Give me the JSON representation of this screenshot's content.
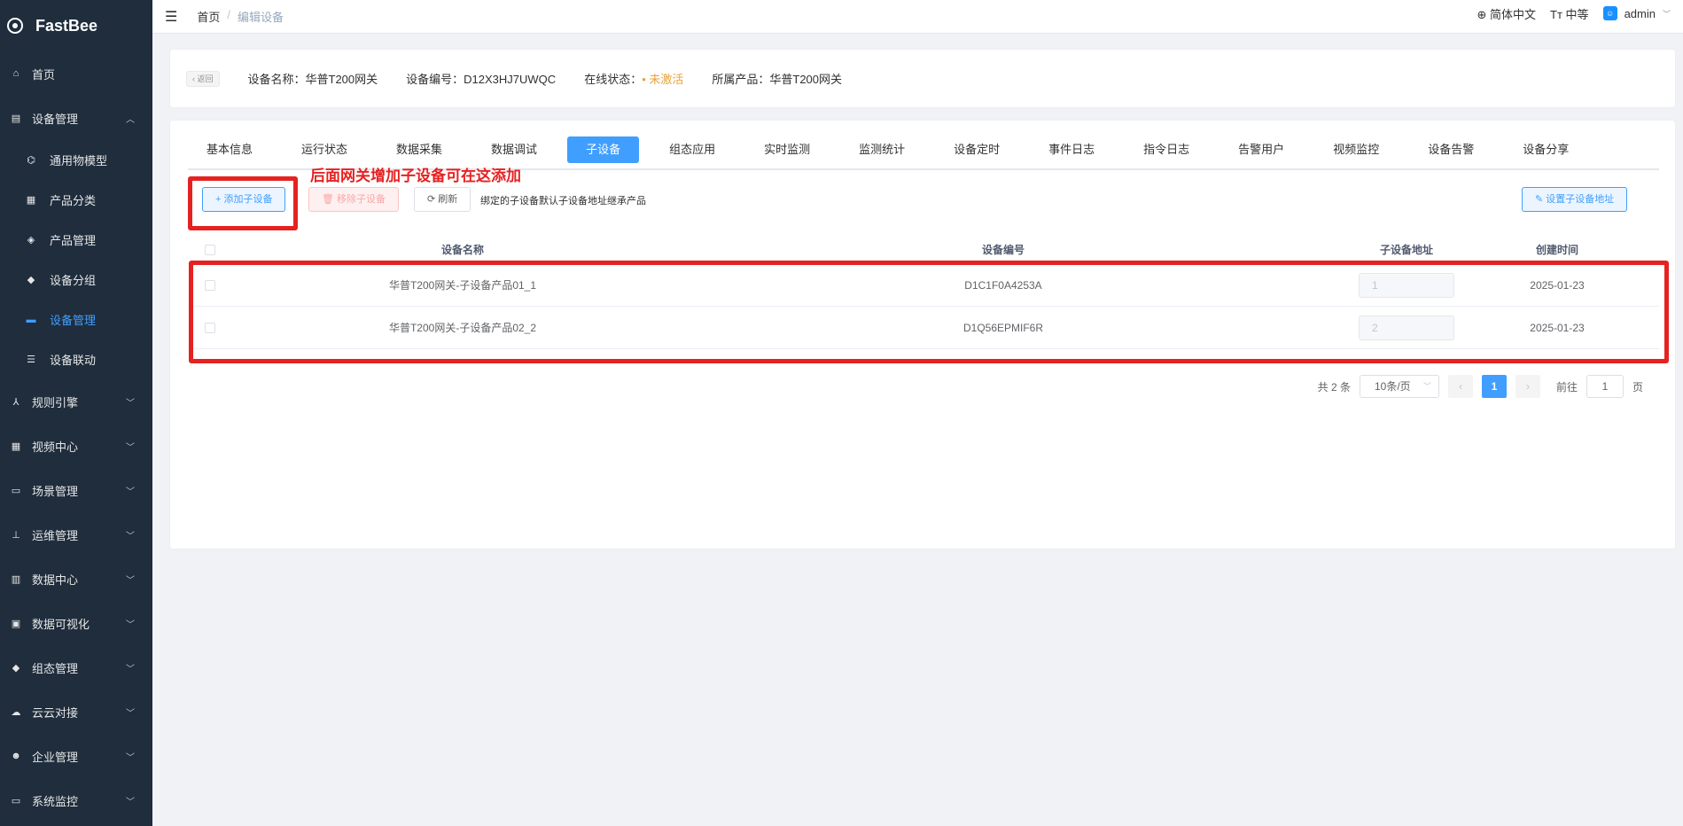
{
  "app": {
    "name": "FastBee"
  },
  "sidebar": {
    "items": [
      {
        "label": "首页",
        "icon": "home-icon",
        "glyph": "⌂"
      },
      {
        "label": "设备管理",
        "icon": "device-icon",
        "glyph": "▤",
        "expanded": true,
        "children": [
          {
            "label": "通用物模型",
            "glyph": "⌬"
          },
          {
            "label": "产品分类",
            "glyph": "▦"
          },
          {
            "label": "产品管理",
            "glyph": "◈"
          },
          {
            "label": "设备分组",
            "glyph": "◆"
          },
          {
            "label": "设备管理",
            "glyph": "▬",
            "active": true
          },
          {
            "label": "设备联动",
            "glyph": "☰"
          }
        ]
      },
      {
        "label": "规则引擎",
        "icon": "rule-icon",
        "glyph": "⅄"
      },
      {
        "label": "视频中心",
        "icon": "video-icon",
        "glyph": "▦"
      },
      {
        "label": "场景管理",
        "icon": "scene-icon",
        "glyph": "▭"
      },
      {
        "label": "运维管理",
        "icon": "ops-icon",
        "glyph": "⊥"
      },
      {
        "label": "数据中心",
        "icon": "data-icon",
        "glyph": "▥"
      },
      {
        "label": "数据可视化",
        "icon": "visual-icon",
        "glyph": "▣"
      },
      {
        "label": "组态管理",
        "icon": "config-icon",
        "glyph": "◆"
      },
      {
        "label": "云云对接",
        "icon": "cloud-icon",
        "glyph": "☁"
      },
      {
        "label": "企业管理",
        "icon": "enterprise-icon",
        "glyph": "☻"
      },
      {
        "label": "系统监控",
        "icon": "monitor-icon",
        "glyph": "▭"
      }
    ]
  },
  "topbar": {
    "breadcrumb": [
      "首页",
      "编辑设备"
    ],
    "language": "简体中文",
    "font_size": "中等",
    "user": "admin"
  },
  "info": {
    "back": "返回",
    "device_name": "设备名称：华普T200网关",
    "device_code": "设备编号：D12X3HJ7UWQC",
    "status_label": "在线状态：",
    "status_value": "• 未激活",
    "product": "所属产品：华普T200网关"
  },
  "tabs": [
    "基本信息",
    "运行状态",
    "数据采集",
    "数据调试",
    "子设备",
    "组态应用",
    "实时监测",
    "监测统计",
    "设备定时",
    "事件日志",
    "指令日志",
    "告警用户",
    "视频监控",
    "设备告警",
    "设备分享"
  ],
  "active_tab": "子设备",
  "toolbar": {
    "add": "+ 添加子设备",
    "remove": "🗑 移除子设备",
    "refresh": "⟳ 刷新",
    "hint": "绑定的子设备默认子设备地址继承产品",
    "set_addr": "✎ 设置子设备地址"
  },
  "annotation": "后面网关增加子设备可在这添加",
  "table": {
    "headers": [
      "设备名称",
      "设备编号",
      "子设备地址",
      "创建时间"
    ],
    "rows": [
      {
        "name": "华普T200网关-子设备产品01_1",
        "code": "D1C1F0A4253A",
        "addr": "1",
        "time": "2025-01-23"
      },
      {
        "name": "华普T200网关-子设备产品02_2",
        "code": "D1Q56EPMIF6R",
        "addr": "2",
        "time": "2025-01-23"
      }
    ]
  },
  "pagination": {
    "total": "共 2 条",
    "page_size": "10条/页",
    "prev": "‹",
    "current": "1",
    "next": "›",
    "goto_label": "前往",
    "goto_value": "1",
    "page_unit": "页"
  }
}
